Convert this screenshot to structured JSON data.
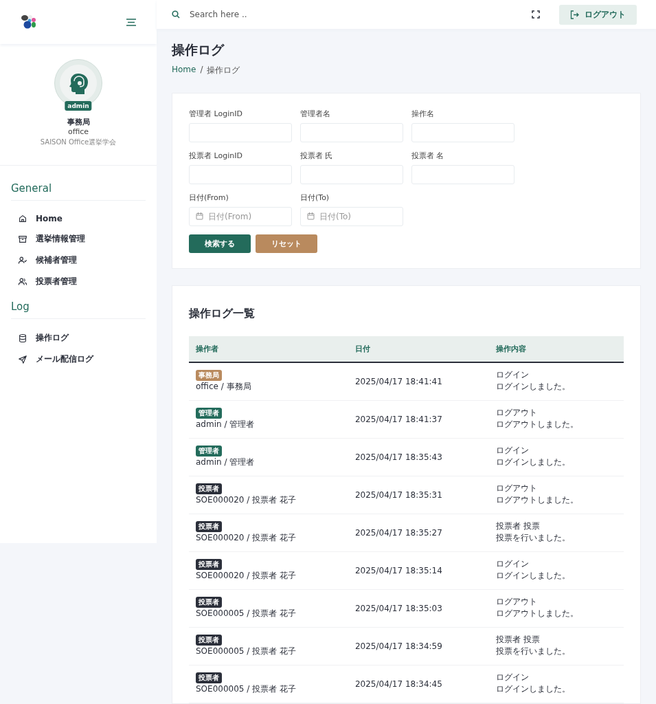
{
  "sidebar": {
    "profile": {
      "role_badge": "admin",
      "name": "事務局",
      "login": "office",
      "organization": "SAISON Office選挙学会"
    },
    "sections": [
      {
        "title": "General",
        "items": [
          {
            "label": "Home"
          },
          {
            "label": "選挙情報管理"
          },
          {
            "label": "候補者管理"
          },
          {
            "label": "投票者管理"
          }
        ]
      },
      {
        "title": "Log",
        "items": [
          {
            "label": "操作ログ"
          },
          {
            "label": "メール配信ログ"
          }
        ]
      }
    ]
  },
  "header": {
    "search": {
      "placeholder": "Search here .."
    },
    "logout_button": "ログアウト"
  },
  "page": {
    "title": "操作ログ",
    "breadcrumb": [
      "Home",
      "操作ログ"
    ],
    "breadcrumb_separator": "/"
  },
  "filters": {
    "fields": [
      {
        "label": "管理者 LoginID",
        "kind": "text"
      },
      {
        "label": "管理者名",
        "kind": "text"
      },
      {
        "label": "操作名",
        "kind": "text"
      },
      {
        "label": "投票者 LoginID",
        "kind": "text"
      },
      {
        "label": "投票者 氏",
        "kind": "text"
      },
      {
        "label": "投票者 名",
        "kind": "text"
      },
      {
        "label": "日付(From)",
        "kind": "date",
        "placeholder": "日付(From)"
      },
      {
        "label": "日付(To)",
        "kind": "date",
        "placeholder": "日付(To)"
      }
    ],
    "buttons": [
      {
        "label": "検索する",
        "kind": "primary"
      },
      {
        "label": "リセット",
        "kind": "secondary"
      }
    ]
  },
  "table": {
    "title": "操作ログ一覧",
    "columns": [
      "操作者",
      "日付",
      "操作内容"
    ],
    "rows": [
      {
        "badge": "事務局",
        "color": "#b98a5e",
        "operator": "office / 事務局",
        "date": "2025/04/17 18:41:41",
        "action": "ログイン",
        "detail": "ログインしました。"
      },
      {
        "badge": "管理者",
        "color": "#236b5b",
        "operator": "admin / 管理者",
        "date": "2025/04/17 18:41:37",
        "action": "ログアウト",
        "detail": "ログアウトしました。"
      },
      {
        "badge": "管理者",
        "color": "#236b5b",
        "operator": "admin / 管理者",
        "date": "2025/04/17 18:35:43",
        "action": "ログイン",
        "detail": "ログインしました。"
      },
      {
        "badge": "投票者",
        "color": "#2b2f3a",
        "operator": "SOE000020 / 投票者 花子",
        "date": "2025/04/17 18:35:31",
        "action": "ログアウト",
        "detail": "ログアウトしました。"
      },
      {
        "badge": "投票者",
        "color": "#2b2f3a",
        "operator": "SOE000020 / 投票者 花子",
        "date": "2025/04/17 18:35:27",
        "action": "投票者 投票",
        "detail": "投票を行いました。"
      },
      {
        "badge": "投票者",
        "color": "#2b2f3a",
        "operator": "SOE000020 / 投票者 花子",
        "date": "2025/04/17 18:35:14",
        "action": "ログイン",
        "detail": "ログインしました。"
      },
      {
        "badge": "投票者",
        "color": "#2b2f3a",
        "operator": "SOE000005 / 投票者 花子",
        "date": "2025/04/17 18:35:03",
        "action": "ログアウト",
        "detail": "ログアウトしました。"
      },
      {
        "badge": "投票者",
        "color": "#2b2f3a",
        "operator": "SOE000005 / 投票者 花子",
        "date": "2025/04/17 18:34:59",
        "action": "投票者 投票",
        "detail": "投票を行いました。"
      },
      {
        "badge": "投票者",
        "color": "#2b2f3a",
        "operator": "SOE000005 / 投票者 花子",
        "date": "2025/04/17 18:34:45",
        "action": "ログイン",
        "detail": "ログインしました。"
      }
    ]
  }
}
